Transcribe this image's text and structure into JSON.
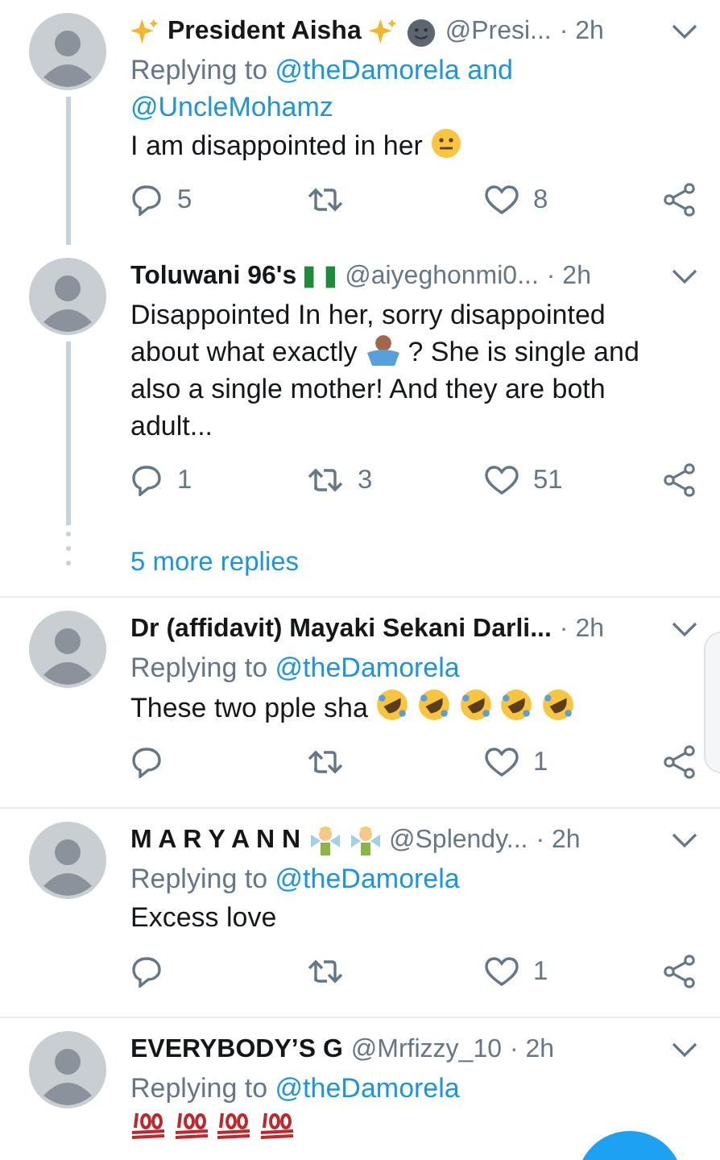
{
  "tweets": [
    {
      "kind": "tweet",
      "name": "President Aisha",
      "name_prefix": [
        {
          "kind": "sparkles"
        }
      ],
      "name_suffix": [
        {
          "kind": "sparkles"
        },
        {
          "kind": "moon-face"
        }
      ],
      "handle": "@Presi...",
      "time": "· 2h",
      "reply": [
        {
          "kind": "plain",
          "text": "Replying to"
        },
        {
          "kind": "link",
          "text": "@theDamorela"
        },
        {
          "kind": "link",
          "text": "and"
        },
        {
          "kind": "link",
          "text": "@UncleMohamz"
        }
      ],
      "body": [
        {
          "kind": "text",
          "text": "I am disappointed in her"
        },
        {
          "kind": "neutral-face"
        }
      ],
      "replies": "5",
      "likes": "8",
      "thread_line": true,
      "divider": false
    },
    {
      "kind": "tweet",
      "name": "Toluwani 96's",
      "name_suffix": [
        {
          "kind": "flag"
        }
      ],
      "handle": "@aiyeghonmi0...",
      "time": "· 2h",
      "body": [
        {
          "kind": "text",
          "text": "Disappointed In her, sorry disappointed about what exactly"
        },
        {
          "kind": "shrug"
        },
        {
          "kind": "text",
          "text": "? She is single and also a single mother! And they are both adult..."
        }
      ],
      "replies": "1",
      "retweets": "3",
      "likes": "51",
      "thread_line": true,
      "divider": false
    },
    {
      "kind": "more",
      "text": "5 more replies",
      "divider": true
    },
    {
      "kind": "tweet",
      "name": "Dr (affidavit) Mayaki Sekani Darli...",
      "time": "· 2h",
      "reply": [
        {
          "kind": "plain",
          "text": "Replying to"
        },
        {
          "kind": "link",
          "text": "@theDamorela"
        }
      ],
      "body": [
        {
          "kind": "text",
          "text": "These two pple sha"
        },
        {
          "kind": "rofl"
        },
        {
          "kind": "rofl"
        },
        {
          "kind": "rofl"
        },
        {
          "kind": "rofl"
        },
        {
          "kind": "rofl"
        }
      ],
      "likes": "1",
      "thread_line": false,
      "divider": true
    },
    {
      "kind": "tweet",
      "name": "M A R Y A N N",
      "name_suffix": [
        {
          "kind": "fairy"
        },
        {
          "kind": "fairy"
        }
      ],
      "handle": "@Splendy...",
      "time": "· 2h",
      "reply": [
        {
          "kind": "plain",
          "text": "Replying to"
        },
        {
          "kind": "link",
          "text": "@theDamorela"
        }
      ],
      "body": [
        {
          "kind": "text",
          "text": "Excess love"
        }
      ],
      "likes": "1",
      "thread_line": false,
      "divider": true
    },
    {
      "kind": "tweet",
      "name": "EVERYBODY’S G",
      "handle": "@Mrfizzy_10",
      "time": "· 2h",
      "reply": [
        {
          "kind": "plain",
          "text": "Replying to"
        },
        {
          "kind": "link",
          "text": "@theDamorela"
        }
      ],
      "body": [
        {
          "kind": "hundred"
        },
        {
          "kind": "hundred"
        },
        {
          "kind": "hundred"
        },
        {
          "kind": "hundred"
        }
      ],
      "thread_line": false,
      "divider": false
    }
  ]
}
